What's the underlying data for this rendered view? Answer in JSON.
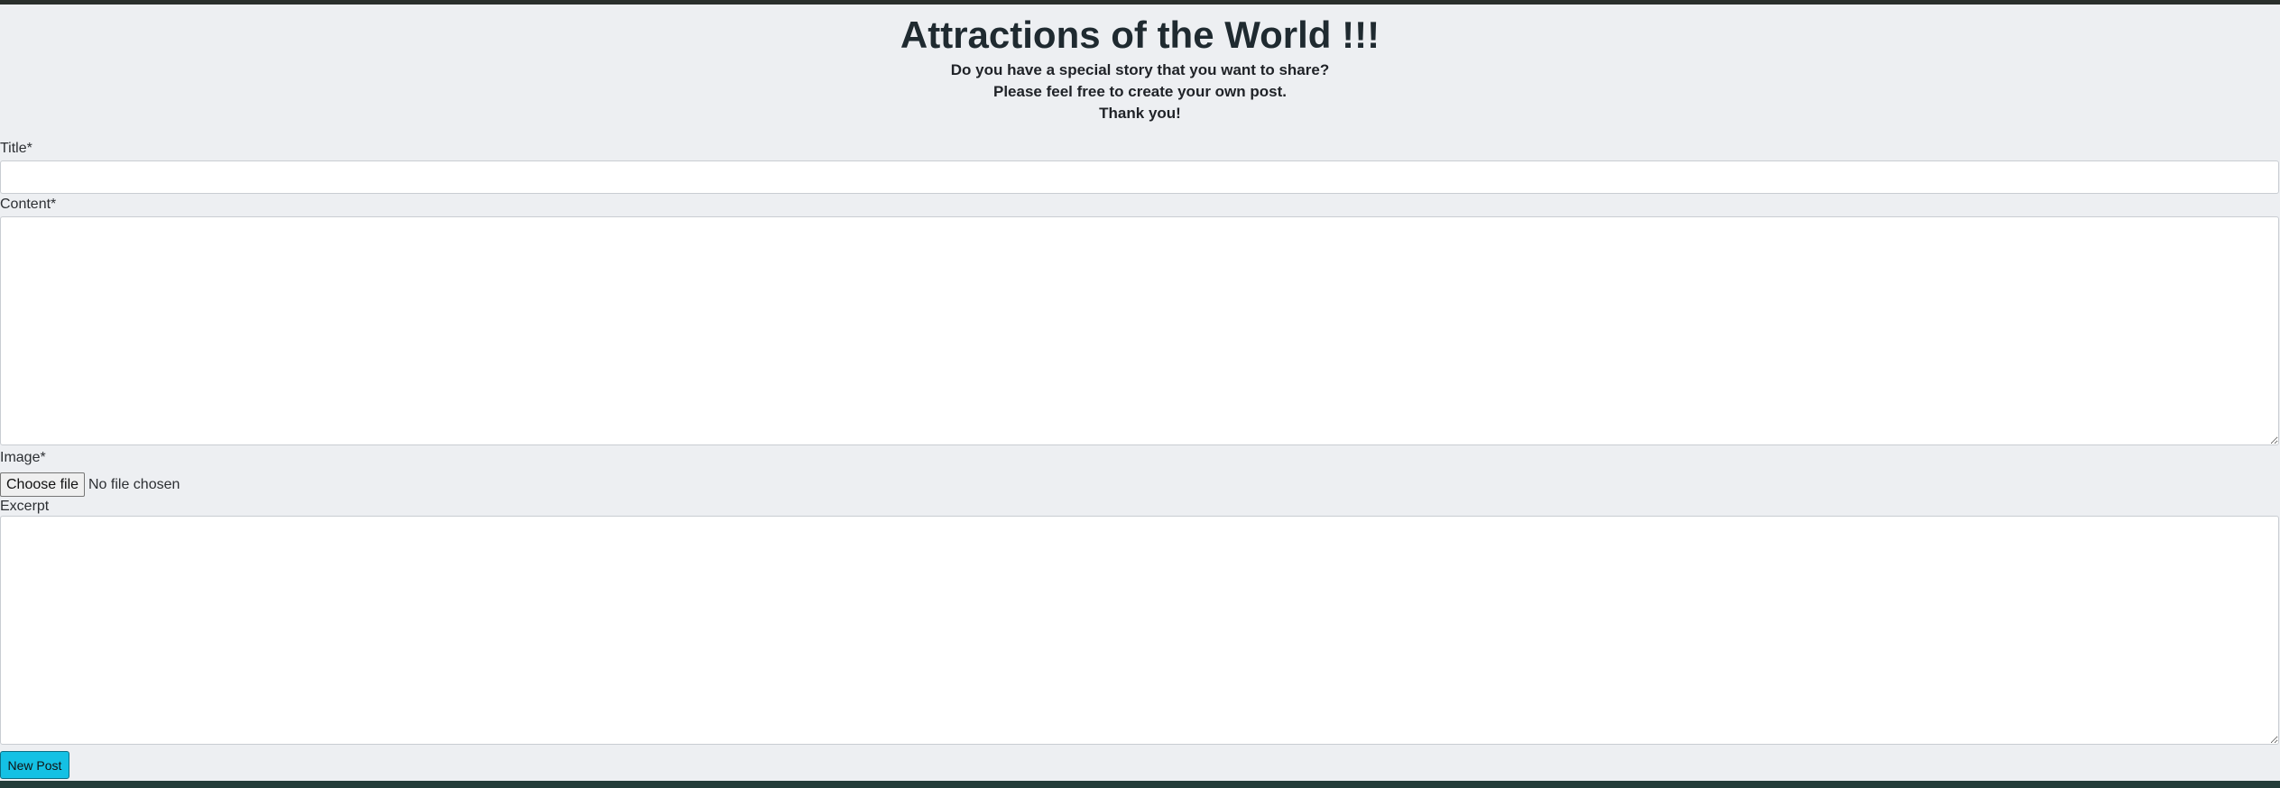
{
  "header": {
    "title": "Attractions of the World !!!",
    "subtitle_lines": [
      "Do you have a special story that you want to share?",
      "Please feel free to create your own post.",
      "Thank you!"
    ]
  },
  "form": {
    "title_label": "Title*",
    "title_value": "",
    "content_label": "Content*",
    "content_value": "",
    "image_label": "Image*",
    "choose_file_label": "Choose file",
    "file_status": "No file chosen",
    "excerpt_label": "Excerpt",
    "excerpt_value": "",
    "submit_label": "New Post"
  },
  "colors": {
    "panel_background": "#edeff2",
    "submit_button": "#14c1e4",
    "border_strip": "#233c39"
  }
}
